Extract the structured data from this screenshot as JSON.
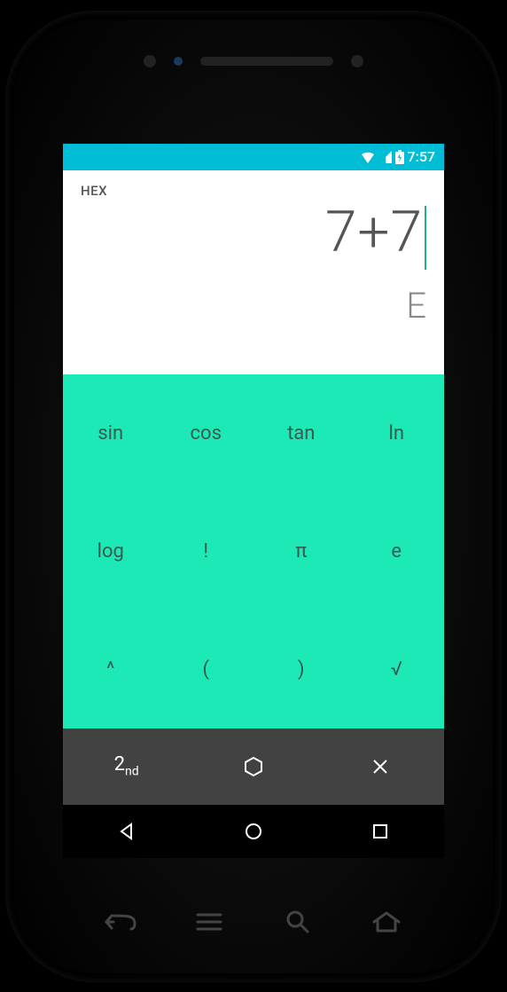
{
  "status_bar": {
    "time": "7:57"
  },
  "display": {
    "mode_label": "HEX",
    "expression": "7+7",
    "result": "E"
  },
  "function_keys": [
    [
      "sin",
      "cos",
      "tan",
      "ln"
    ],
    [
      "log",
      "!",
      "π",
      "e"
    ],
    [
      "^",
      "(",
      ")",
      "√"
    ]
  ],
  "bottom_bar": {
    "second": "2nd",
    "hex_icon": "hexagon",
    "close": "×"
  },
  "nav_bar": {
    "back": "back",
    "home": "home",
    "recent": "recent"
  }
}
